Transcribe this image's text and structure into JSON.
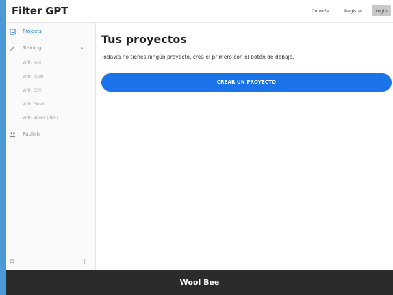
{
  "header": {
    "app_title": "Filter GPT",
    "nav": {
      "console": "Console",
      "register": "Register",
      "login": "Login"
    }
  },
  "sidebar": {
    "items": [
      {
        "label": "Projects",
        "icon": "projects-icon",
        "active": true
      },
      {
        "label": "Training",
        "icon": "training-icon",
        "expanded": true
      },
      {
        "label": "Publish",
        "icon": "publish-icon"
      }
    ],
    "training_subitems": [
      "With text",
      "With JSON",
      "With CSV",
      "With Excel",
      "With Books (PDF)"
    ],
    "footer_icons": [
      "settings-icon",
      "collapse-icon"
    ]
  },
  "main": {
    "title": "Tus proyectos",
    "description": "Todavía no tienes ningún proyecto, crea el primero con el botón de debajo.",
    "create_button": "CREAR UN PROYECTO"
  },
  "footer": {
    "text": "Wool Bee"
  },
  "colors": {
    "accent": "#1a73e8",
    "active_nav": "#1976d2",
    "footer_bg": "#2b2b2b",
    "outer_bg": "#4a9ad8"
  }
}
